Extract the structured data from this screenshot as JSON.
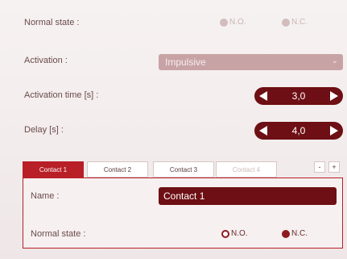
{
  "normal_state": {
    "label": "Normal state :",
    "options": [
      "N.O.",
      "N.C."
    ]
  },
  "activation": {
    "label": "Activation :",
    "value": "Impulsive"
  },
  "activation_time": {
    "label": "Activation time [s] :",
    "value": "3,0"
  },
  "delay": {
    "label": "Delay [s] :",
    "value": "4,0"
  },
  "tabs": [
    {
      "label": "Contact 1",
      "state": "active"
    },
    {
      "label": "Contact 2",
      "state": "normal"
    },
    {
      "label": "Contact 3",
      "state": "normal"
    },
    {
      "label": "Contact 4",
      "state": "disabled"
    }
  ],
  "tab_controls": {
    "minus": "-",
    "plus": "+"
  },
  "contact": {
    "name_label": "Name :",
    "name_value": "Contact 1",
    "normal_state_label": "Normal state :",
    "options": [
      "N.O.",
      "N.C."
    ],
    "selected": "N.O."
  },
  "colors": {
    "accent": "#b81f26",
    "dark_accent": "#6d0f14",
    "disabled": "#c8a3a6"
  }
}
